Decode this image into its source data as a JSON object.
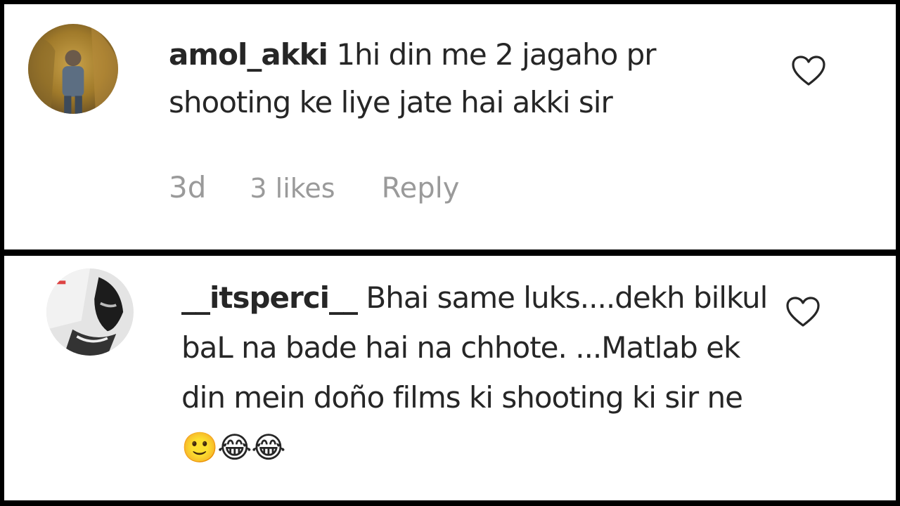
{
  "comments": [
    {
      "username": "amol_akki",
      "text": " 1hi din me 2 jagaho pr shooting ke liye jate hai akki sir",
      "time": "3d",
      "likes": "3 likes",
      "reply": "Reply",
      "heart_icon": "heart-outline-icon"
    },
    {
      "username": "__itsperci__",
      "text": " Bhai same luks....dekh bilkul baL na bade hai na chhote. ...Matlab ek din mein doño films ki shooting ki sir ne 🙂😂😂",
      "heart_icon": "heart-outline-icon"
    }
  ],
  "colors": {
    "text": "#262626",
    "meta": "#9a9a9a",
    "divider": "#000000"
  }
}
